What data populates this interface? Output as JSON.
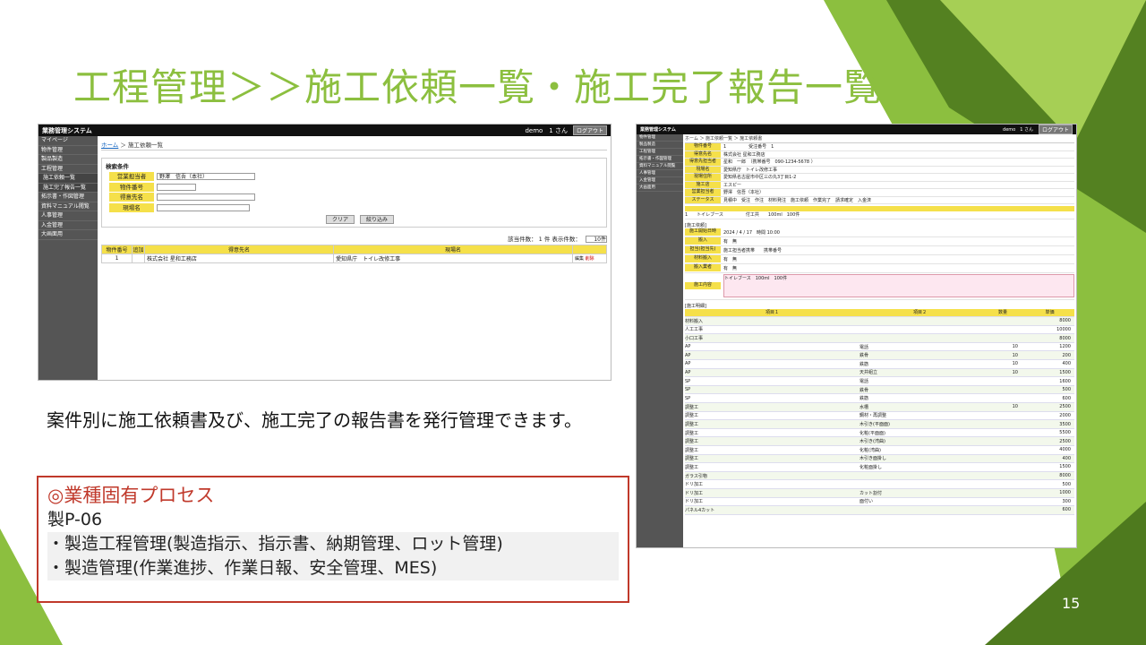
{
  "slide": {
    "title": "工程管理＞＞施工依頼一覧・施工完了報告一覧",
    "description": "案件別に施工依頼書及び、施工完了の報告書を発行管理できます。",
    "box_heading": "◎業種固有プロセス",
    "box_code": "製P-06",
    "box_items": [
      "・製造工程管理(製造指示、指示書、納期管理、ロット管理)",
      "・製造管理(作業進捗、作業日報、安全管理、MES)"
    ],
    "page_number": "15"
  },
  "screen1": {
    "app_title": "業務管理システム",
    "user": "demo　1 さん",
    "logout": "ログアウト",
    "menu": [
      "マイページ",
      "物件管理",
      "製品製造",
      "工程管理",
      "施工依頼一覧",
      "施工完了報告一覧",
      "拓示書・作図管理",
      "資料マニュアル閲覧",
      "人事管理",
      "入金管理",
      "大画面用"
    ],
    "crumb_home": "ホーム",
    "crumb_sep": "＞",
    "crumb_current": "施工依頼一覧",
    "search_title": "検索条件",
    "fields": [
      {
        "label": "営業担当者",
        "value": "野澤　信吾（本社）"
      },
      {
        "label": "物件番号",
        "value": ""
      },
      {
        "label": "得意先名",
        "value": ""
      },
      {
        "label": "現場名",
        "value": ""
      }
    ],
    "clear": "クリア",
    "filter": "絞り込み",
    "count": "該当件数：  1  件  表示件数：",
    "per_page": "10件",
    "columns": [
      "物件番号",
      "追加",
      "得意先名",
      "現場名"
    ],
    "rows": [
      {
        "no": "1",
        "add": "",
        "client": "株式会社 星和工務店",
        "site": "愛知県庁　トイレ改修工事",
        "act1": "編集",
        "act2": "削除"
      }
    ]
  },
  "screen2": {
    "app_title": "業務管理システム",
    "user": "demo　1 さん",
    "logout": "ログアウト",
    "menu": [
      "物件管理",
      "製品製造",
      "工程管理",
      "拓示書・作図管理",
      "資料マニュアル閲覧",
      "人事管理",
      "入金管理",
      "大画面用"
    ],
    "crumb": "ホーム ＞ 施工依頼一覧 ＞ 施工依頼書",
    "info": [
      {
        "l": "物件番号",
        "v": "1　　　　　受注番号　1"
      },
      {
        "l": "得意先名",
        "v": "株式会社 星和工務店"
      },
      {
        "l": "得意先担当者",
        "v": "星和　一郎　（携帯番号　090-1234-5678 ）"
      },
      {
        "l": "現場名",
        "v": "愛知県庁　トイレ改修工事"
      },
      {
        "l": "現場住所",
        "v": "愛知県名古屋市中区三の丸3丁目1-2"
      },
      {
        "l": "施工店",
        "v": "エスピー"
      },
      {
        "l": "営業担当者",
        "v": "野澤　信吾（本社）"
      },
      {
        "l": "ステータス",
        "v": "見積中　受注　作注　材料発注　施工依頼　作業完了　請求確定　入金済"
      }
    ],
    "item_row": "1　　トイレブース　　　　　付工共　　100ml　100件",
    "sec_request": "[施工依頼]",
    "req": [
      {
        "l": "施工開始日時",
        "v": "2024 / 4 / 17　時間 10:00"
      },
      {
        "l": "搬入",
        "v": "有　無"
      },
      {
        "l": "担当(担当先)",
        "v": "施工担当者携帯　　携帯番号"
      },
      {
        "l": "材料搬入",
        "v": "有　無"
      },
      {
        "l": "搬入業者",
        "v": "有　無"
      },
      {
        "l": "施工内容",
        "v": "トイレブース　100ml　100件"
      }
    ],
    "sec_detail": "[施工明細]",
    "detail_head": [
      "項目１",
      "項目２",
      "数量",
      "単価"
    ],
    "detail": [
      [
        "材料搬入",
        "",
        "",
        "8000"
      ],
      [
        "人工工事",
        "",
        "",
        "10000"
      ],
      [
        "小口工事",
        "",
        "",
        "8000"
      ],
      [
        "AP",
        "電話",
        "10",
        "1200"
      ],
      [
        "AP",
        "鉄骨",
        "10",
        "200"
      ],
      [
        "AP",
        "鉄筋",
        "10",
        "400"
      ],
      [
        "AP",
        "天井組立",
        "10",
        "1500"
      ],
      [
        "SP",
        "電話",
        "",
        "1600"
      ],
      [
        "SP",
        "鉄骨",
        "",
        "500"
      ],
      [
        "SP",
        "鉄筋",
        "",
        "600"
      ],
      [
        "調整工",
        "水槽",
        "10",
        "2500"
      ],
      [
        "調整工",
        "鋼材・再調整",
        "",
        "2000"
      ],
      [
        "調整工",
        "木引き(平面面)",
        "",
        "3500"
      ],
      [
        "調整工",
        "化粧(平面面)",
        "",
        "5500"
      ],
      [
        "調整工",
        "木引き(湾曲)",
        "",
        "2500"
      ],
      [
        "調整工",
        "化粧(湾曲)",
        "",
        "4000"
      ],
      [
        "調整工",
        "木引き面掛し",
        "",
        "400"
      ],
      [
        "調整工",
        "化粧面掛し",
        "",
        "1500"
      ],
      [
        "ガラス引物",
        "",
        "",
        "8000"
      ],
      [
        "ドリ加工",
        "",
        "",
        "500"
      ],
      [
        "ドリ加工",
        "カット割付",
        "",
        "1000"
      ],
      [
        "ドリ加工",
        "面付い",
        "",
        "300"
      ],
      [
        "パネル4カット",
        "",
        "",
        "600"
      ]
    ]
  }
}
